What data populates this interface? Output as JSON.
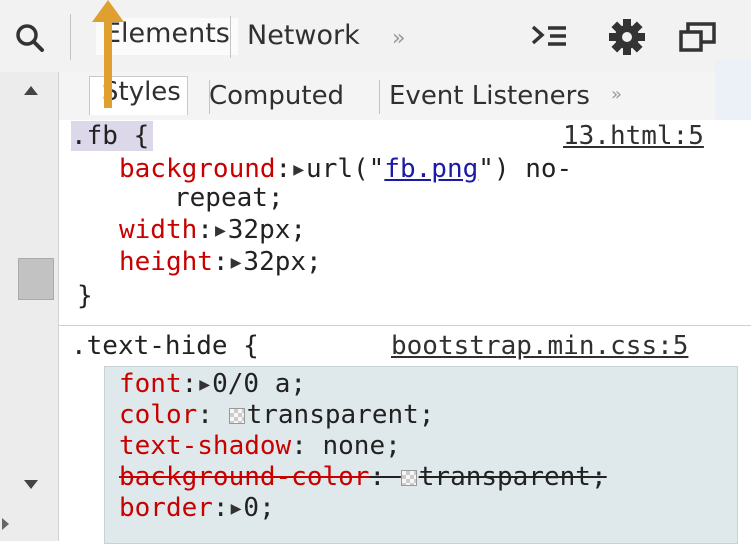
{
  "toolbar": {
    "elements_tab": "Elements",
    "network_tab": "Network",
    "more_tabs": "»"
  },
  "subtabs": {
    "styles": "Styles",
    "computed": "Computed",
    "event_listeners": "Event Listeners",
    "more": "»"
  },
  "rules": [
    {
      "selector": ".fb {",
      "source": "13.html:5",
      "properties": [
        {
          "name": "background",
          "value_prefix": "url(\"",
          "link": "fb.png",
          "value_suffix": "\") no-",
          "continuation": "repeat;"
        },
        {
          "name": "width",
          "value": "32px;"
        },
        {
          "name": "height",
          "value": "32px;"
        }
      ],
      "close": "}"
    },
    {
      "selector": ".text-hide {",
      "source": "bootstrap.min.css:5",
      "properties": [
        {
          "name": "font",
          "value": "0/0 a;"
        },
        {
          "name": "color",
          "value": "transparent;"
        },
        {
          "name": "text-shadow",
          "value": "none;"
        },
        {
          "name": "background-color",
          "value": "transparent;"
        },
        {
          "name": "border",
          "value": "0;"
        }
      ]
    }
  ],
  "accent": {
    "property_name": "#c80000",
    "selected_selector": "#dcd8ea",
    "annotation_arrow": "#e0a030"
  },
  "icons": [
    "search-icon",
    "console-drawer-icon",
    "settings-gear-icon",
    "dock-window-icon",
    "annotation-arrow-icon"
  ]
}
